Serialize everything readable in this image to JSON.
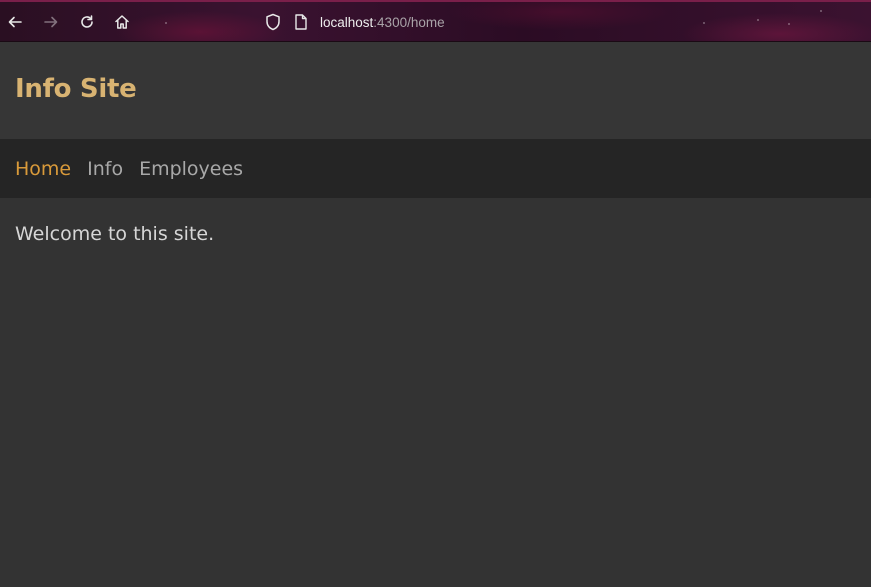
{
  "browser": {
    "url_host": "localhost",
    "url_rest": ":4300/home",
    "icons": [
      "back-arrow-icon",
      "forward-arrow-icon",
      "reload-icon",
      "home-icon",
      "shield-icon",
      "page-icon"
    ]
  },
  "header": {
    "title": "Info Site"
  },
  "nav": {
    "items": [
      {
        "label": "Home",
        "active": true
      },
      {
        "label": "Info",
        "active": false
      },
      {
        "label": "Employees",
        "active": false
      }
    ]
  },
  "main": {
    "welcome_text": "Welcome to this site."
  },
  "colors": {
    "title": "#d8b372",
    "nav_active": "#d99a3a",
    "nav_inactive": "#a8a8a8",
    "page_bg": "#333333",
    "nav_bg": "#252525"
  }
}
